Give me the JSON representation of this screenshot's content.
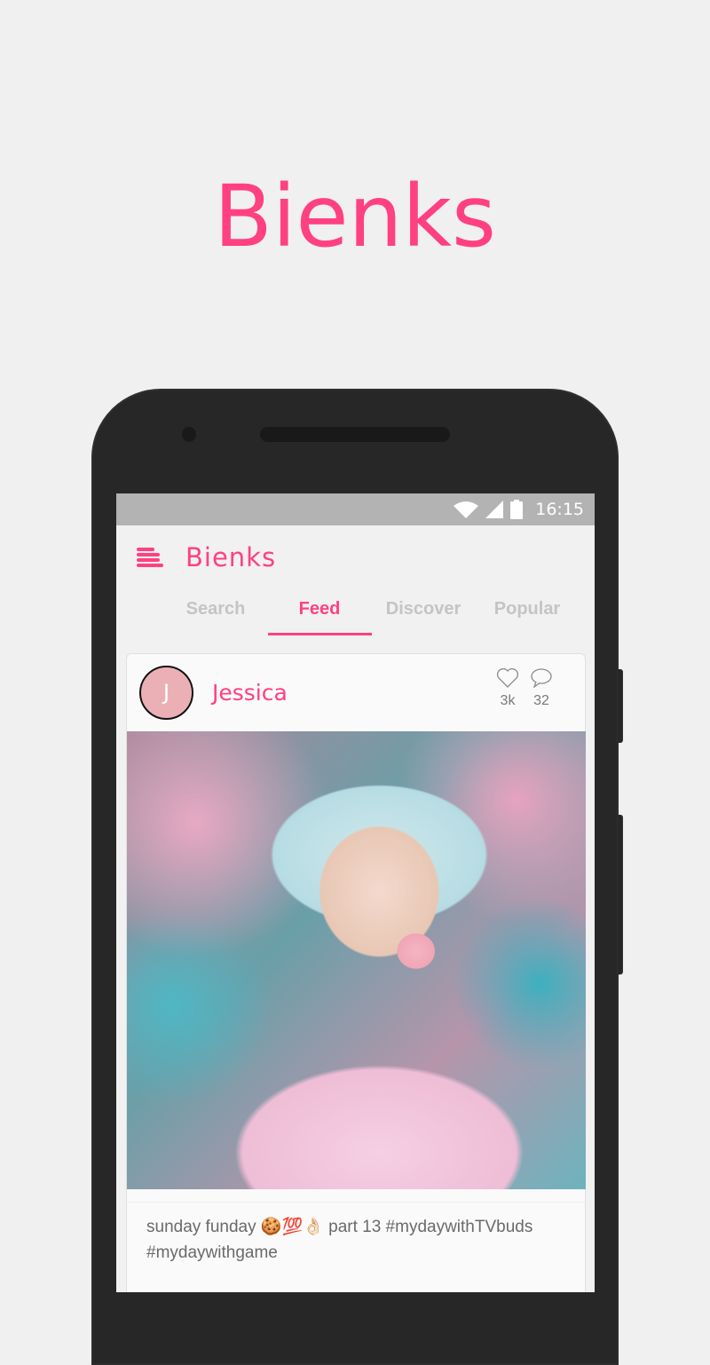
{
  "headline": "Bienks",
  "status_bar": {
    "time": "16:15",
    "icons": [
      "wifi-icon",
      "signal-icon",
      "battery-icon"
    ]
  },
  "app_bar": {
    "menu_icon": "menu-icon",
    "title": "Bienks"
  },
  "tabs": [
    {
      "label": "Search",
      "active": false
    },
    {
      "label": "Feed",
      "active": true
    },
    {
      "label": "Discover",
      "active": false
    },
    {
      "label": "Popular",
      "active": false
    }
  ],
  "post": {
    "avatar_initial": "J",
    "username": "Jessica",
    "likes": "3k",
    "comments": "32",
    "image_alt": "Woman in a light blue sun hat blowing a pink bubble gum bubble",
    "caption": "sunday funday 🍪💯👌🏻 part 13 #mydaywithTVbuds #mydaywithgame"
  },
  "colors": {
    "accent": "#ff4081",
    "background": "#f0f0f0",
    "status_bar": "#b3b3b3",
    "phone_body": "#272727",
    "tab_inactive": "#c4c4c4"
  }
}
